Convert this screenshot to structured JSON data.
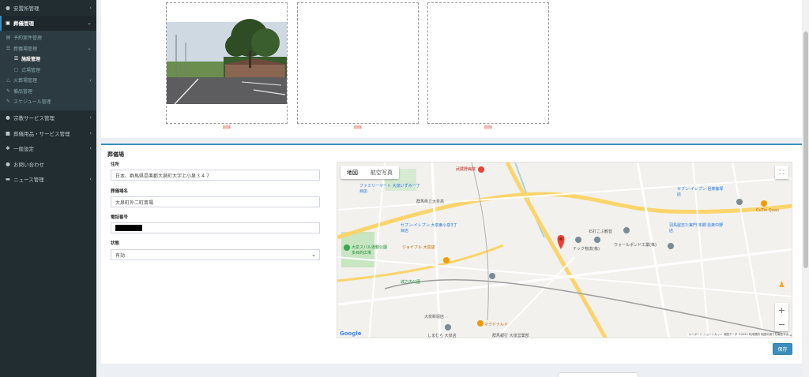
{
  "sidebar": {
    "items": [
      {
        "label": "安置所管理",
        "icon": "home-icon"
      },
      {
        "label": "葬儀管理",
        "icon": "dashboard-icon"
      },
      {
        "label": "宗教サービス管理",
        "icon": "circle-icon"
      },
      {
        "label": "葬儀用品・サービス管理",
        "icon": "box-icon"
      },
      {
        "label": "一般設定",
        "icon": "gear-icon"
      },
      {
        "label": "お問い合わせ",
        "icon": "info-icon"
      },
      {
        "label": "ニュース管理",
        "icon": "news-icon"
      }
    ],
    "funeral_sub": {
      "reservation": "予約案件管理",
      "hall": "葬儀場管理",
      "facility": "施設管理",
      "ceremony": "式場管理",
      "cremation": "火葬場管理",
      "equipment": "備品管理",
      "schedule": "スケジュール管理"
    }
  },
  "photos": {
    "delete_label": "削除"
  },
  "form": {
    "title": "葬儀場",
    "address_label": "住所",
    "address_value": "日本、群馬県邑楽郡大泉町大字上小泉３４７",
    "name_label": "葬儀場名",
    "name_value": "大泉町外二町斎場",
    "phone_label": "電話番号",
    "status_label": "状態",
    "status_value": "有効",
    "save_label": "保存"
  },
  "map": {
    "tab_map": "地図",
    "tab_satellite": "航空写真",
    "zoom_in": "+",
    "zoom_out": "−",
    "google": "Google",
    "attribution": "キーボード ショートカット  地図データ ©2022  利用規約  地図の誤りを報告する",
    "labels": [
      "武蔵野病院",
      "ファミリーマート 大泉いずみ一丁目店",
      "群馬県立大泉高",
      "セブン-イレブン 大泉東小泉3丁目店",
      "ジョイフル 大泉店",
      "大泉スバル運動公園 多目的広場",
      "城之内公園",
      "石打こぶ観音",
      "ウォールポンド工業(株)",
      "テック物流(株)",
      "CuTin Quan",
      "大泉新堀店",
      "マクドナルド",
      "群馬銀行 大泉営業部",
      "しまむら 大泉店",
      "セブン-イレブン 邑楽篠塚店",
      "羽鳥屋志た実門 本郷 邑楽中野店"
    ]
  }
}
